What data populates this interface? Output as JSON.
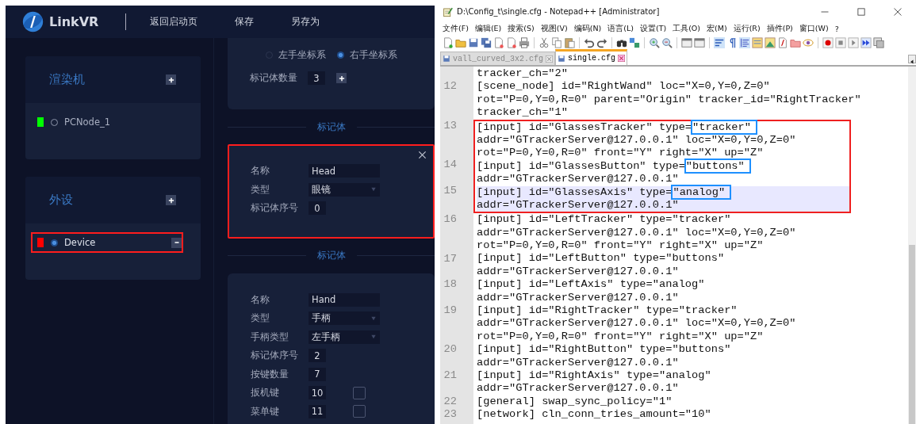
{
  "app": {
    "logo_text": "LinkVR",
    "nav": [
      "返回启动页",
      "保存",
      "另存为"
    ],
    "sidebar": [
      {
        "title": "渲染机",
        "items": [
          {
            "label": "PCNode_1",
            "color": "#00ff00",
            "selected": false,
            "removable": false,
            "annotated": false
          }
        ]
      },
      {
        "title": "外设",
        "items": [
          {
            "label": "Device",
            "color": "#ff0000",
            "selected": true,
            "removable": true,
            "annotated": true
          }
        ]
      }
    ],
    "coordinate_options": [
      {
        "label": "左手坐标系",
        "selected": false
      },
      {
        "label": "右手坐标系",
        "selected": true
      }
    ],
    "marker_count": {
      "label": "标记体数量",
      "value": "3"
    },
    "markers": [
      {
        "heading": "标记体",
        "annotated": true,
        "closable": true,
        "fields": [
          {
            "kind": "text",
            "label": "名称",
            "value": "Head"
          },
          {
            "kind": "select",
            "label": "类型",
            "value": "眼镜"
          },
          {
            "kind": "number",
            "label": "标记体序号",
            "value": "0"
          }
        ]
      },
      {
        "heading": "标记体",
        "annotated": false,
        "closable": false,
        "fields": [
          {
            "kind": "text",
            "label": "名称",
            "value": "Hand"
          },
          {
            "kind": "select",
            "label": "类型",
            "value": "手柄"
          },
          {
            "kind": "select",
            "label": "手柄类型",
            "value": "左手柄"
          },
          {
            "kind": "number",
            "label": "标记体序号",
            "value": "2"
          },
          {
            "kind": "number",
            "label": "按键数量",
            "value": "7"
          },
          {
            "kind": "check",
            "label": "扳机键",
            "value": "10",
            "checked": false
          },
          {
            "kind": "check",
            "label": "菜单键",
            "value": "11",
            "checked": false
          }
        ]
      }
    ]
  },
  "editor_window": {
    "title": "D:\\Config_t\\single.cfg - Notepad++ [Administrator]",
    "menu": [
      "文件(F)",
      "编辑(E)",
      "搜索(S)",
      "视图(V)",
      "编码(N)",
      "语言(L)",
      "设置(T)",
      "工具(O)",
      "宏(M)",
      "运行(R)",
      "插件(P)",
      "窗口(W)",
      "?"
    ],
    "tabs": [
      {
        "label": "vall_curved_3x2.cfg",
        "selected": false
      },
      {
        "label": "single.cfg",
        "selected": true
      }
    ],
    "blocks": [
      {
        "annotated": false,
        "lines": [
          {
            "rows": [
              {
                "text": "tracker_ch=\"2\""
              }
            ],
            "current": false
          },
          {
            "number": "12",
            "rows": [
              {
                "text": "[scene_node] id=\"RightWand\" loc=\"X=0,Y=0,Z=0\""
              },
              {
                "text": "rot=\"P=0,Y=0,R=0\" parent=\"Origin\" tracker_id=\"RightTracker\""
              },
              {
                "text": "tracker_ch=\"1\""
              }
            ],
            "current": false
          }
        ]
      },
      {
        "annotated": true,
        "lines": [
          {
            "number": "13",
            "rows": [
              {
                "text": "[input] id=\"GlassesTracker\" type=",
                "boxed": "\"tracker\""
              },
              {
                "text": "addr=\"GTrackerServer@127.0.0.1\" loc=\"X=0,Y=0,Z=0\""
              },
              {
                "text": "rot=\"P=0,Y=0,R=0\" front=\"Y\" right=\"X\" up=\"Z\""
              }
            ],
            "current": false
          },
          {
            "number": "14",
            "rows": [
              {
                "text": "[input] id=\"GlassesButton\" type=",
                "boxed": "\"buttons\""
              },
              {
                "text": "addr=\"GTrackerServer@127.0.0.1\""
              }
            ],
            "current": false
          },
          {
            "number": "15",
            "rows": [
              {
                "text": "[input] id=\"GlassesAxis\" type=",
                "boxed": "\"analog\""
              },
              {
                "text": "addr=\"GTrackerServer@127.0.0.1\""
              }
            ],
            "current": true
          }
        ]
      },
      {
        "annotated": false,
        "lines": [
          {
            "number": "16",
            "rows": [
              {
                "text": "[input] id=\"LeftTracker\" type=\"tracker\""
              },
              {
                "text": "addr=\"GTrackerServer@127.0.0.1\" loc=\"X=0,Y=0,Z=0\""
              },
              {
                "text": "rot=\"P=0,Y=0,R=0\" front=\"Y\" right=\"X\" up=\"Z\""
              }
            ],
            "current": false
          },
          {
            "number": "17",
            "rows": [
              {
                "text": "[input] id=\"LeftButton\" type=\"buttons\""
              },
              {
                "text": "addr=\"GTrackerServer@127.0.0.1\""
              }
            ],
            "current": false
          },
          {
            "number": "18",
            "rows": [
              {
                "text": "[input] id=\"LeftAxis\" type=\"analog\""
              },
              {
                "text": "addr=\"GTrackerServer@127.0.0.1\""
              }
            ],
            "current": false
          },
          {
            "number": "19",
            "rows": [
              {
                "text": "[input] id=\"RightTracker\" type=\"tracker\""
              },
              {
                "text": "addr=\"GTrackerServer@127.0.0.1\" loc=\"X=0,Y=0,Z=0\""
              },
              {
                "text": "rot=\"P=0,Y=0,R=0\" front=\"Y\" right=\"X\" up=\"Z\""
              }
            ],
            "current": false
          },
          {
            "number": "20",
            "rows": [
              {
                "text": "[input] id=\"RightButton\" type=\"buttons\""
              },
              {
                "text": "addr=\"GTrackerServer@127.0.0.1\""
              }
            ],
            "current": false
          },
          {
            "number": "21",
            "rows": [
              {
                "text": "[input] id=\"RightAxis\" type=\"analog\""
              },
              {
                "text": "addr=\"GTrackerServer@127.0.0.1\""
              }
            ],
            "current": false
          },
          {
            "number": "22",
            "rows": [
              {
                "text": "[general] swap_sync_policy=\"1\""
              }
            ],
            "current": false
          },
          {
            "number": "23",
            "rows": [
              {
                "text": "[network] cln_conn_tries_amount=\"10\""
              }
            ],
            "current": false
          }
        ]
      }
    ]
  }
}
